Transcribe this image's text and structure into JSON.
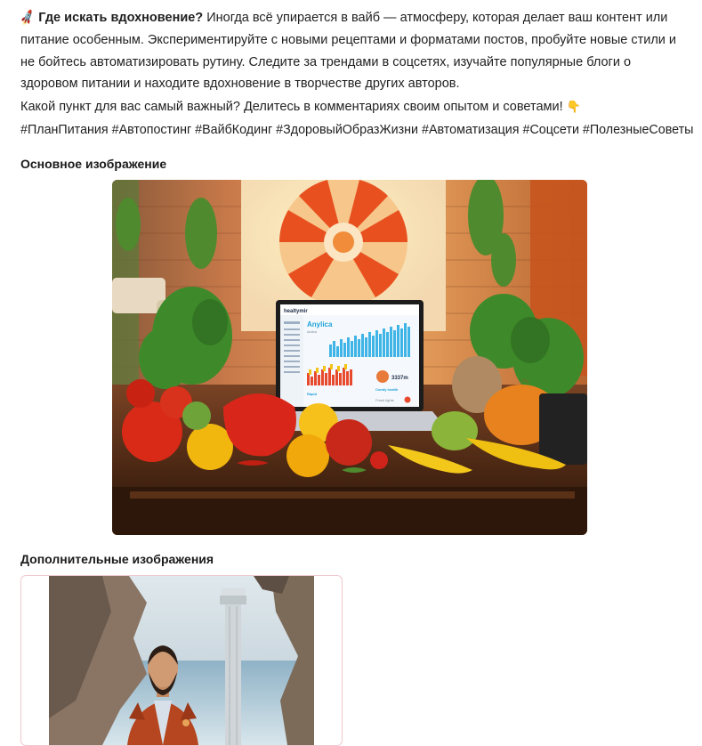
{
  "post": {
    "heading": "Где искать вдохновение?",
    "body": " Иногда всё упирается в вайб — атмосферу, которая делает ваш контент или питание особенным. Экспериментируйте с новыми рецептами и форматами постов, пробуйте новые стили и не бойтесь автоматизировать рутину. Следите за трендами в соцсетях, изучайте популярные блоги о здоровом питании и находите вдохновение в творчестве других авторов.",
    "question": "Какой пункт для вас самый важный? Делитесь в комментариях своим опытом и советами!",
    "hashtags": "#ПланПитания #Автопостинг #ВайбКодинг #ЗдоровыйОбразЖизни #Автоматизация #Соцсети #ПолезныеСоветы"
  },
  "sections": {
    "main_image_title": "Основное изображение",
    "extra_images_title": "Дополнительные изображения"
  },
  "icons": {
    "rocket": "rocket-emoji",
    "pointing": "backhand-index-pointing-down-emoji"
  },
  "images": {
    "main": {
      "description_text": "",
      "laptop_logo": "healtymir",
      "laptop_heading": "Anylica",
      "laptop_sub": "Activa",
      "laptop_stat": "3337m",
      "laptop_card1": "Rapid",
      "laptop_card2": "Comfy health",
      "laptop_card3": "Fresh lights"
    }
  },
  "colors": {
    "text": "#1f1f1f",
    "card_border": "#f0c8cf"
  }
}
